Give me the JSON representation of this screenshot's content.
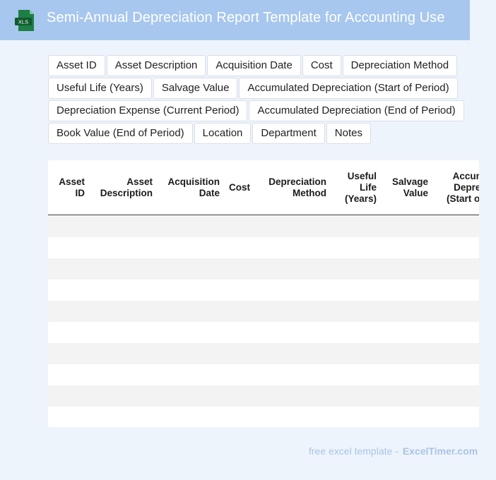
{
  "header": {
    "icon_label": "XLS",
    "title": "Semi-Annual Depreciation Report Template for Accounting Use",
    "color": "#a7c7ee"
  },
  "chips": [
    [
      "Asset ID",
      "Asset Description",
      "Acquisition Date",
      "Cost",
      "Depreciation Method"
    ],
    [
      "Useful Life (Years)",
      "Salvage Value",
      "Accumulated Depreciation (Start of Period)"
    ],
    [
      "Depreciation Expense (Current Period)",
      "Accumulated Depreciation (End of Period)"
    ],
    [
      "Book Value (End of Period)",
      "Location",
      "Department",
      "Notes"
    ]
  ],
  "table": {
    "headers": [
      "Asset\nID",
      "Asset\nDescription",
      "Acquisition\nDate",
      "Cost",
      "Depreciation\nMethod",
      "Useful\nLife\n(Years)",
      "Salvage\nValue",
      "Accumulated\nDepreciation\n(Start of Period)"
    ],
    "row_count": 10
  },
  "footer": {
    "prefix": "free excel template -",
    "brand": "ExcelTimer.com"
  }
}
